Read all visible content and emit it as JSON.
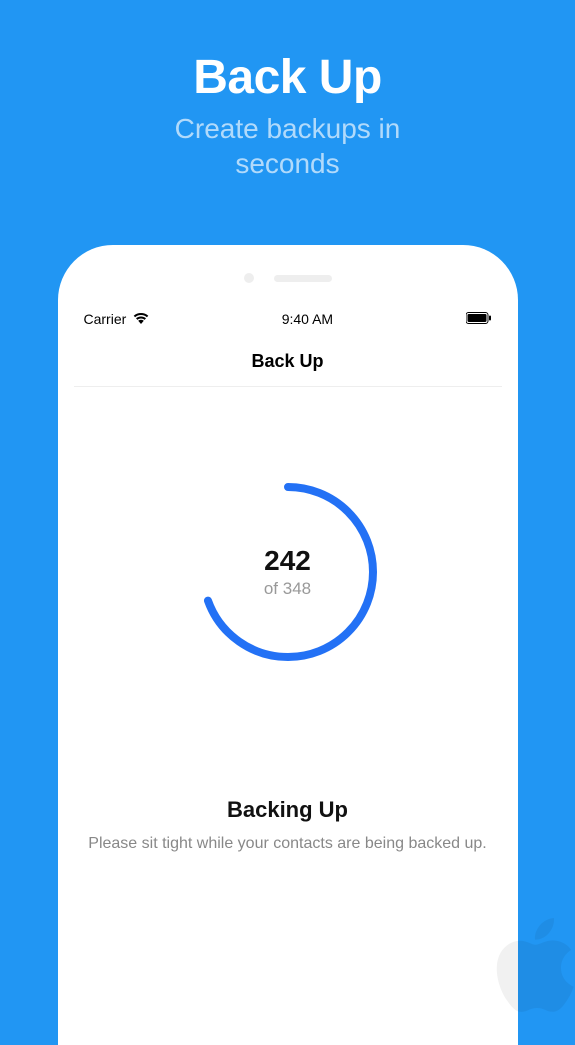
{
  "promo": {
    "title": "Back Up",
    "subtitle_line1": "Create backups in",
    "subtitle_line2": "seconds"
  },
  "status_bar": {
    "carrier": "Carrier",
    "time": "9:40 AM"
  },
  "nav": {
    "title": "Back Up"
  },
  "progress": {
    "current": "242",
    "total_prefix": "of",
    "total": "348",
    "fraction": 0.695
  },
  "status": {
    "title": "Backing Up",
    "description": "Please sit tight while your contacts are being backed up."
  },
  "colors": {
    "accent": "#2371F5"
  }
}
